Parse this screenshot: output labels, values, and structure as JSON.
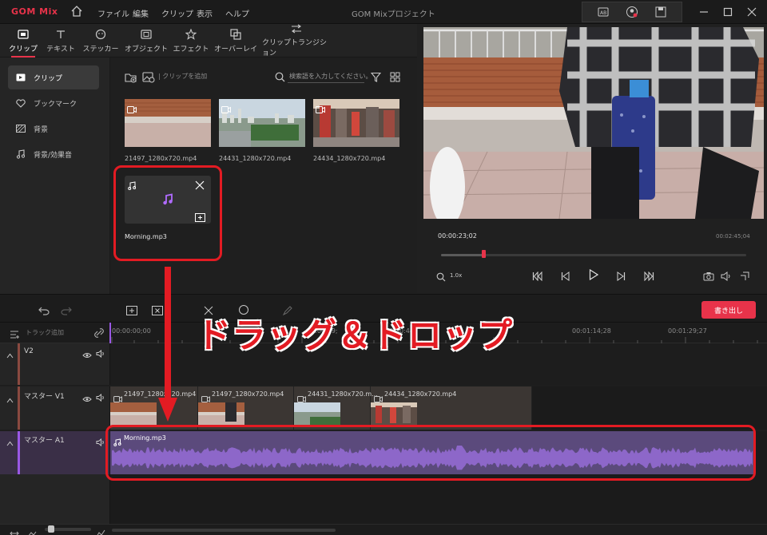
{
  "app": {
    "logo": "GOM Mix",
    "window_title": "GOM Mixプロジェクト",
    "menu": [
      "ファイル",
      "編集",
      "クリップ",
      "表示",
      "ヘルプ"
    ],
    "icons": [
      "home-icon",
      "subtitle-icon",
      "account-icon",
      "save-icon",
      "minimize-icon",
      "maximize-icon",
      "close-icon"
    ]
  },
  "tabs": [
    {
      "label": "クリップ",
      "icon": "clip-icon",
      "active": true
    },
    {
      "label": "テキスト",
      "icon": "text-icon"
    },
    {
      "label": "ステッカー",
      "icon": "sticker-icon"
    },
    {
      "label": "オブジェクト",
      "icon": "object-icon"
    },
    {
      "label": "エフェクト",
      "icon": "effect-icon"
    },
    {
      "label": "オーバーレイ",
      "icon": "overlay-icon"
    },
    {
      "label": "クリップトランジション",
      "icon": "transition-icon"
    }
  ],
  "sidebar": {
    "items": [
      {
        "label": "クリップ",
        "icon": "clip-icon",
        "active": true
      },
      {
        "label": "ブックマーク",
        "icon": "heart-icon"
      },
      {
        "label": "背景",
        "icon": "background-icon"
      },
      {
        "label": "背景/効果音",
        "icon": "music-icon"
      }
    ]
  },
  "library": {
    "add_clip_label": "| クリップを追加",
    "search_placeholder": "検索語を入力してください。",
    "clips": [
      {
        "name": "21497_1280x720.mp4"
      },
      {
        "name": "24431_1280x720.mp4"
      },
      {
        "name": "24434_1280x720.mp4"
      }
    ],
    "audio_clip": {
      "name": "Morning.mp3"
    }
  },
  "preview": {
    "current_time": "00:00:23;02",
    "total_time": "00:02:45;04",
    "zoom": "1.0x",
    "progress": 0.14
  },
  "timeline": {
    "add_track_label": "トラック追加",
    "export_label": "書き出し",
    "ruler": [
      "00:00:00;00",
      "00:00:29;",
      "00:00:44;",
      "00:01:14;28",
      "00:01:29;27"
    ],
    "tracks": [
      {
        "name": "V2"
      },
      {
        "name": "マスター V1"
      },
      {
        "name": "マスター A1"
      }
    ],
    "video_clips": [
      {
        "label": "21497_1280x720.mp4"
      },
      {
        "label": "21497_1280x720.mp4"
      },
      {
        "label": "24431_1280x720.m..."
      },
      {
        "label": "24434_1280x720.mp4"
      }
    ],
    "audio_clip_label": "Morning.mp3"
  },
  "annotation": {
    "text": "ドラッグ＆ドロップ",
    "color": "#e31b23"
  }
}
